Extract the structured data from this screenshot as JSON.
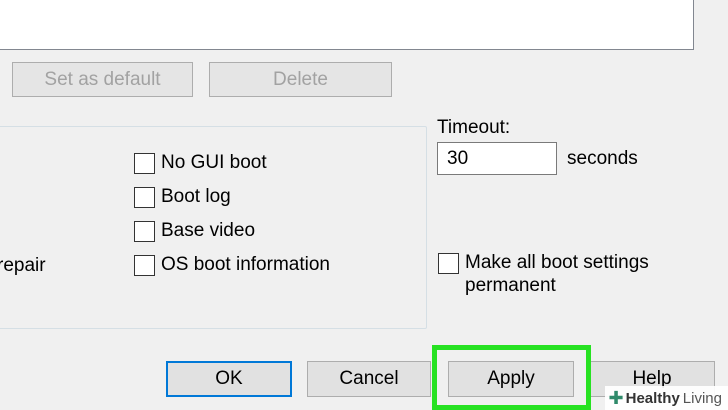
{
  "buttons_top": {
    "set_default": "Set as default",
    "delete": "Delete"
  },
  "boot_options": {
    "left_partial": "repair",
    "checkboxes": [
      {
        "label": "No GUI boot",
        "checked": false
      },
      {
        "label": "Boot log",
        "checked": false
      },
      {
        "label": "Base video",
        "checked": false
      },
      {
        "label": "OS boot information",
        "checked": false
      }
    ]
  },
  "timeout": {
    "label": "Timeout:",
    "value": "30",
    "unit": "seconds"
  },
  "permanent": {
    "line1": "Make all boot settings",
    "line2": "permanent",
    "checked": false
  },
  "buttons_bottom": {
    "ok": "OK",
    "cancel": "Cancel",
    "apply": "Apply",
    "help": "Help"
  },
  "watermark": {
    "icon": "plus-cross-icon",
    "brand1": "Healthy",
    "brand2": "Living"
  },
  "colors": {
    "highlight": "#27e222",
    "default_button_border": "#0078d7"
  }
}
